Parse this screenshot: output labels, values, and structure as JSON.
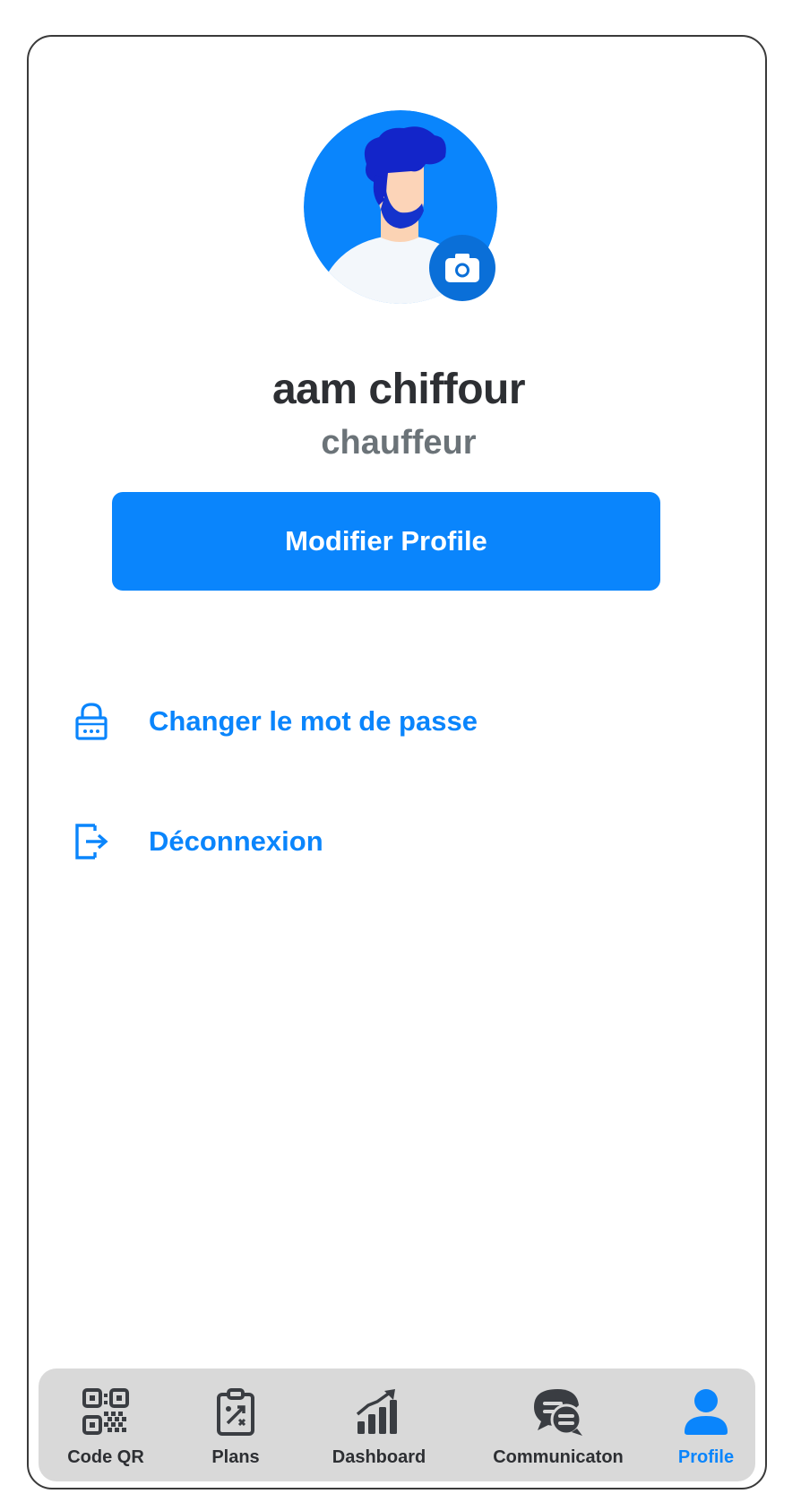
{
  "profile": {
    "name": "aam chiffour",
    "role": "chauffeur",
    "edit_label": "Modifier Profile"
  },
  "menu": {
    "items": [
      {
        "label": "Changer le mot de passe",
        "icon": "lock-icon"
      },
      {
        "label": "Déconnexion",
        "icon": "logout-icon"
      }
    ]
  },
  "nav": {
    "items": [
      {
        "label": "Code QR",
        "icon": "qr-code-icon",
        "active": false
      },
      {
        "label": "Plans",
        "icon": "clipboard-plan-icon",
        "active": false
      },
      {
        "label": "Dashboard",
        "icon": "bar-chart-icon",
        "active": false
      },
      {
        "label": "Communicaton",
        "icon": "chat-bubbles-icon",
        "active": false
      },
      {
        "label": "Profile",
        "icon": "user-icon",
        "active": true
      }
    ]
  },
  "colors": {
    "accent": "#0a85fc",
    "camera": "#0a6fd8",
    "nav_bg": "#d9d9d9",
    "text_dark": "#2d2f33",
    "text_muted": "#6b7378"
  }
}
